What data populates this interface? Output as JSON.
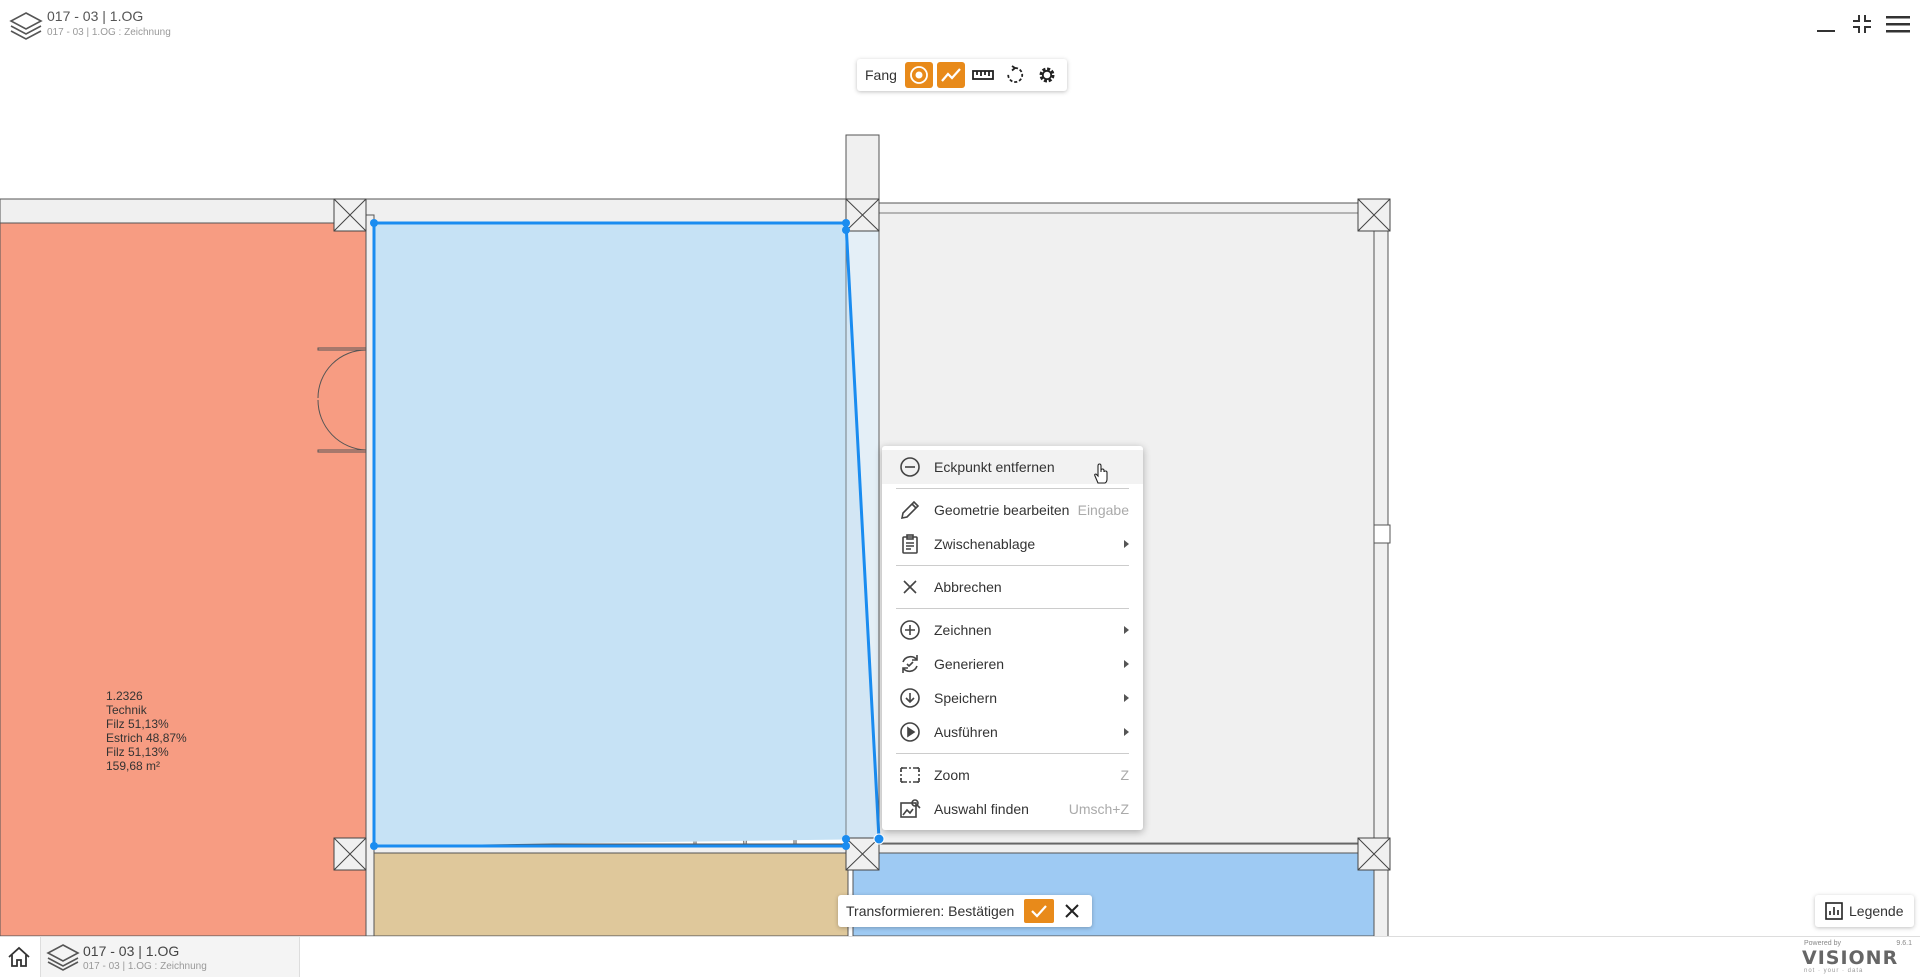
{
  "header": {
    "title": "017 - 03 | 1.OG",
    "subtitle": "017 - 03 | 1.OG : Zeichnung",
    "icons": [
      "layers-icon",
      "minimize-icon",
      "compress-icon",
      "menu-icon"
    ]
  },
  "snap_toolbar": {
    "label": "Fang",
    "tools": [
      {
        "name": "snap-point",
        "icon": "target-icon",
        "active": true
      },
      {
        "name": "snap-line",
        "icon": "trend-line-icon",
        "active": true
      },
      {
        "name": "measure",
        "icon": "ruler-icon",
        "active": false
      },
      {
        "name": "rotate",
        "icon": "rotate-icon",
        "active": false
      },
      {
        "name": "settings",
        "icon": "gear-icon",
        "active": false
      }
    ],
    "active_color": "#e88a1a"
  },
  "room": {
    "id": "1.2326",
    "name": "Technik",
    "lines": [
      "Filz 51,13%",
      "Estrich 48,87%",
      "Filz 51,13%"
    ],
    "area": "159,68 m²"
  },
  "context_menu": {
    "items": [
      {
        "icon": "minus-circle-icon",
        "label": "Eckpunkt entfernen",
        "shortcut": "",
        "submenu": false,
        "hover": true
      },
      {
        "sep": true
      },
      {
        "icon": "pencil-icon",
        "label": "Geometrie bearbeiten",
        "shortcut": "Eingabe",
        "submenu": false
      },
      {
        "icon": "clipboard-icon",
        "label": "Zwischenablage",
        "shortcut": "",
        "submenu": true
      },
      {
        "sep": true
      },
      {
        "icon": "close-icon",
        "label": "Abbrechen",
        "shortcut": "",
        "submenu": false
      },
      {
        "sep": true
      },
      {
        "icon": "plus-circle-icon",
        "label": "Zeichnen",
        "shortcut": "",
        "submenu": true
      },
      {
        "icon": "generate-icon",
        "label": "Generieren",
        "shortcut": "",
        "submenu": true
      },
      {
        "icon": "download-circle-icon",
        "label": "Speichern",
        "shortcut": "",
        "submenu": true
      },
      {
        "icon": "play-circle-icon",
        "label": "Ausführen",
        "shortcut": "",
        "submenu": true
      },
      {
        "sep": true
      },
      {
        "icon": "zoom-frame-icon",
        "label": "Zoom",
        "shortcut": "Z",
        "submenu": false
      },
      {
        "icon": "find-selection-icon",
        "label": "Auswahl finden",
        "shortcut": "Umsch+Z",
        "submenu": false
      }
    ]
  },
  "transform_bar": {
    "label": "Transformieren: Bestätigen",
    "confirm_icon": "check-icon",
    "cancel_icon": "close-icon"
  },
  "legend": {
    "label": "Legende",
    "icon": "chart-icon"
  },
  "bottom_bar": {
    "home_icon": "home-icon",
    "tab_title": "017 - 03 | 1.OG",
    "tab_subtitle": "017 - 03 | 1.OG : Zeichnung",
    "brand": {
      "powered": "Powered by",
      "logo": "VISIONR",
      "version": "9.6.1",
      "tagline": "not · your · data"
    }
  },
  "colors": {
    "room_red": "#f79c82",
    "room_selected": "#c6e2f5",
    "room_beige": "#dfc89b",
    "room_blue": "#9ecaf3",
    "room_grey": "#f0f0f0",
    "selection": "#1a8cf0"
  }
}
